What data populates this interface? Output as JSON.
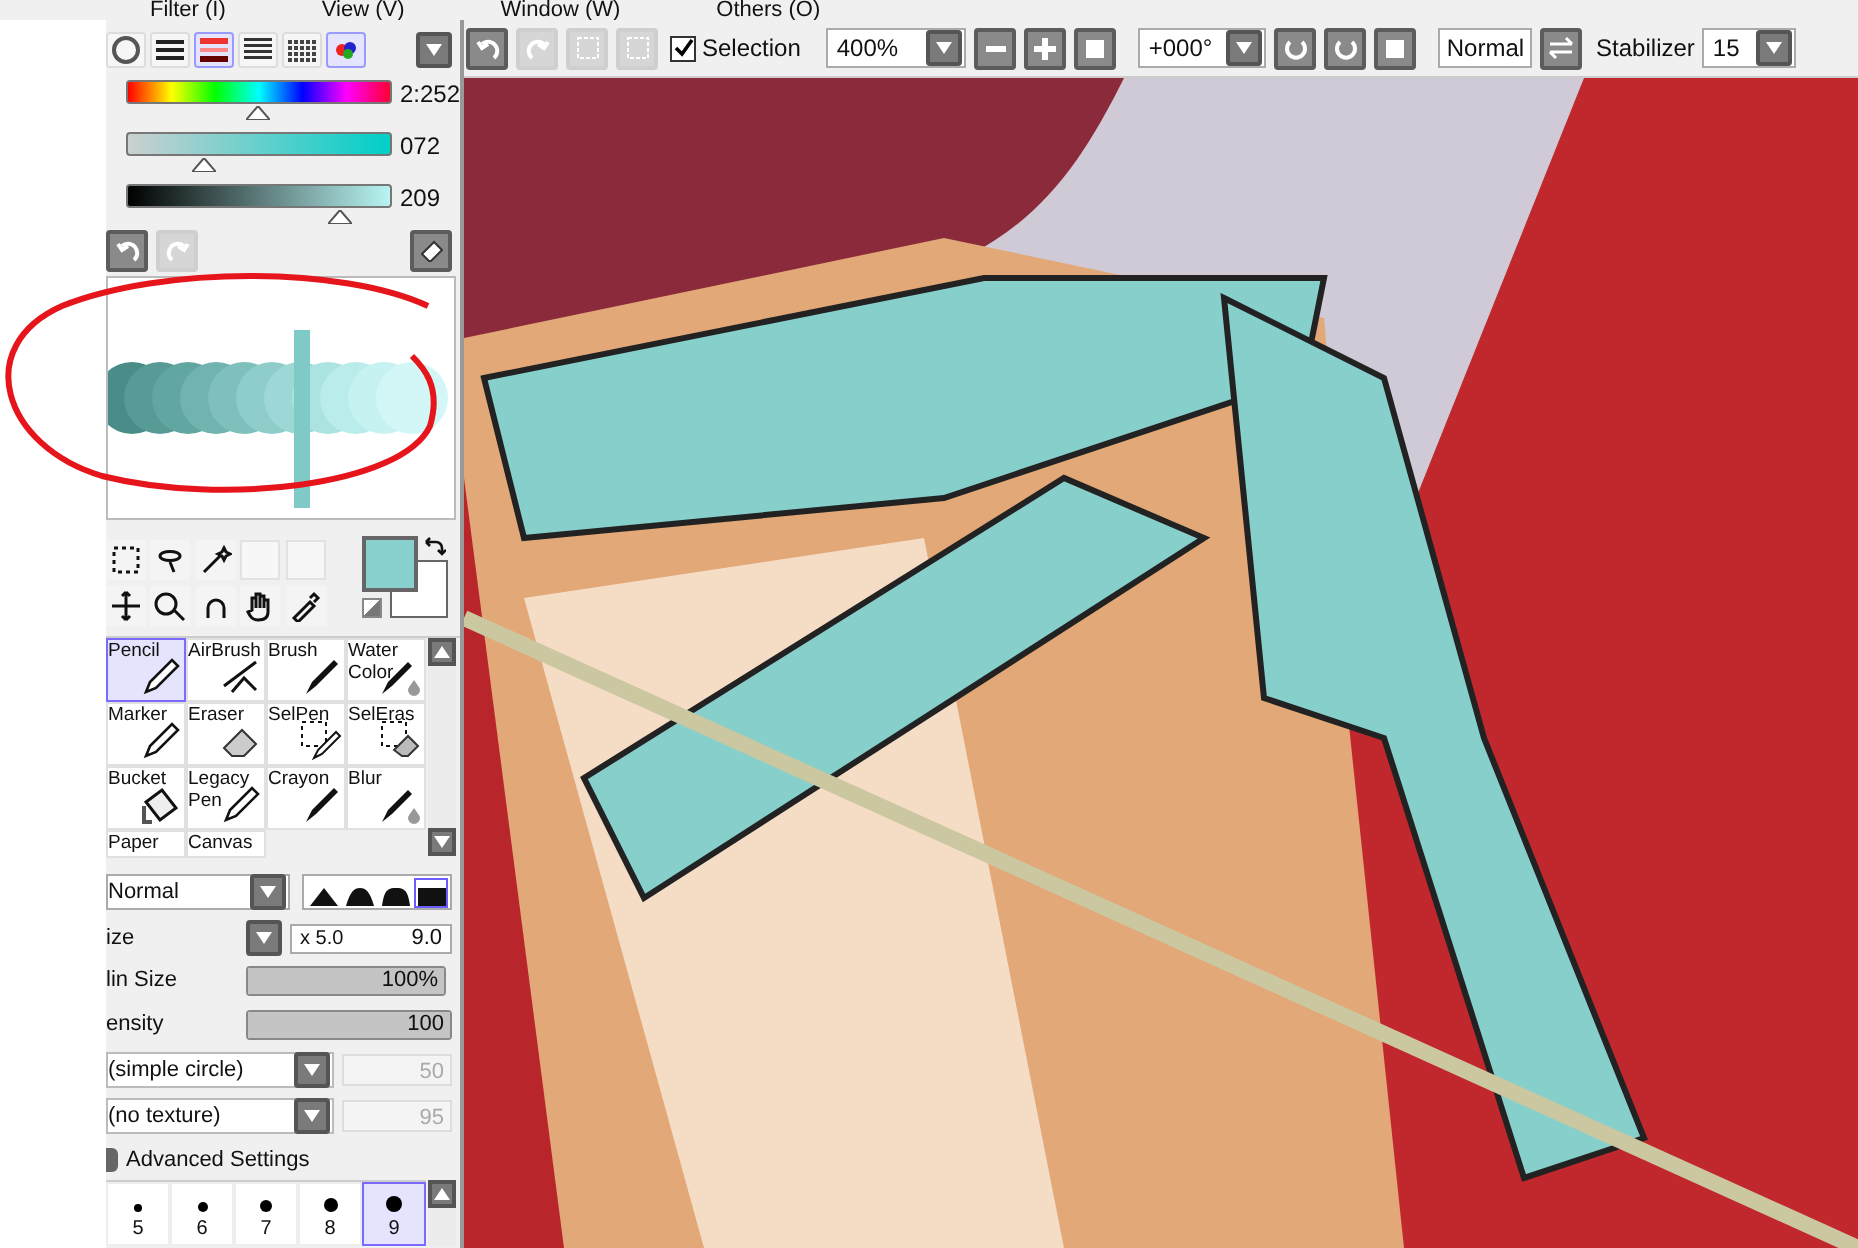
{
  "menu": [
    "Filter (I)",
    "View (V)",
    "Window (W)",
    "Others (O)"
  ],
  "color_modes": [
    {
      "kind": "wheel",
      "selected": false
    },
    {
      "kind": "rgb",
      "selected": false
    },
    {
      "kind": "hsv",
      "selected": true
    },
    {
      "kind": "swatches",
      "selected": false
    },
    {
      "kind": "grid",
      "selected": false
    },
    {
      "kind": "scratch",
      "selected": true
    }
  ],
  "sliders": [
    {
      "kind": "hue",
      "level": 0.5,
      "reading": "2:252"
    },
    {
      "kind": "sat",
      "level": 0.29,
      "reading": "072"
    },
    {
      "kind": "val",
      "level": 0.81,
      "reading": "209"
    }
  ],
  "toolbar": {
    "selection": {
      "label": "Selection",
      "checked": true
    },
    "zoom": "400%",
    "rotation": "+000°",
    "blend": "Normal",
    "stabilizer_label": "Stabilizer",
    "stabilizer": "15"
  },
  "tools": [
    {
      "label": "Pencil",
      "kind": "pencil",
      "selected": true
    },
    {
      "label": "AirBrush",
      "kind": "airbrush",
      "selected": false
    },
    {
      "label": "Brush",
      "kind": "brush",
      "selected": false
    },
    {
      "label": "Water Color",
      "kind": "water",
      "selected": false
    },
    {
      "label": "Marker",
      "kind": "pencil",
      "selected": false
    },
    {
      "label": "Eraser",
      "kind": "eraser",
      "selected": false
    },
    {
      "label": "SelPen",
      "kind": "selpen",
      "selected": false
    },
    {
      "label": "SelEras",
      "kind": "seleras",
      "selected": false
    },
    {
      "label": "Bucket",
      "kind": "bucket",
      "selected": false
    },
    {
      "label": "Legacy Pen",
      "kind": "pencil",
      "selected": false
    },
    {
      "label": "Crayon",
      "kind": "brush",
      "selected": false
    },
    {
      "label": "Blur",
      "kind": "water",
      "selected": false
    },
    {
      "label": "Paper",
      "kind": "none",
      "selected": false
    },
    {
      "label": "Canvas",
      "kind": "none",
      "selected": false
    }
  ],
  "mode": "Normal",
  "shapes": [
    {
      "selected": false
    },
    {
      "selected": false
    },
    {
      "selected": false
    },
    {
      "selected": true
    }
  ],
  "size": {
    "label": "ize",
    "multiplier": "x 5.0",
    "value": "9.0"
  },
  "min_size": {
    "label": "lin Size",
    "value": "100%",
    "level": 1
  },
  "density": {
    "label": "ensity",
    "value": "100",
    "level": 1
  },
  "shape_select": {
    "value": "(simple circle)",
    "amount": "50"
  },
  "texture_select": {
    "value": "(no texture)",
    "amount": "95"
  },
  "advanced": {
    "label": "Advanced Settings",
    "checked": false
  },
  "brush_sizes": [
    {
      "label": "5",
      "selected": false
    },
    {
      "label": "6",
      "selected": false
    },
    {
      "label": "7",
      "selected": false
    },
    {
      "label": "8",
      "selected": false
    },
    {
      "label": "9",
      "selected": true
    }
  ]
}
